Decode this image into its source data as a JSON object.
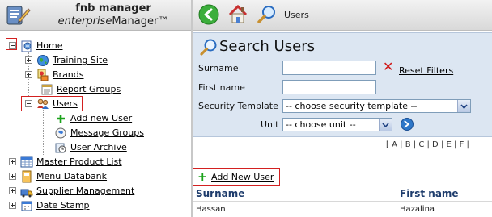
{
  "app": {
    "name": "fnb manager",
    "subtitle_prefix": "enterprise",
    "subtitle_rest": "Manager™"
  },
  "tree": {
    "home": "Home",
    "training_site": "Training Site",
    "brands": "Brands",
    "report_groups": "Report Groups",
    "users": "Users",
    "add_new_user": "Add new User",
    "message_groups": "Message Groups",
    "user_archive": "User Archive",
    "master_product_list": "Master Product List",
    "menu_databank": "Menu Databank",
    "supplier_management": "Supplier Management",
    "date_stamp": "Date Stamp"
  },
  "toolbar": {
    "title": "Users"
  },
  "search": {
    "title": "Search Users",
    "surname_label": "Surname",
    "surname_value": "",
    "first_name_label": "First name",
    "first_name_value": "",
    "security_template_label": "Security Template",
    "security_template_value": "-- choose security template --",
    "unit_label": "Unit",
    "unit_value": "-- choose unit --",
    "reset_filters": "Reset Filters"
  },
  "alpha_index": [
    "[",
    "A",
    "|",
    "B",
    "|",
    "C",
    "|",
    "D",
    "|",
    "E",
    "|",
    "F",
    "|"
  ],
  "add_new_user": "Add New User",
  "grid": {
    "columns": [
      "Surname",
      "First name"
    ],
    "rows": [
      [
        "Hassan",
        "Hazalina"
      ]
    ]
  },
  "colors": {
    "highlight_box": "#d32020",
    "search_panel_bg": "#dce6f2",
    "grid_header_text": "#1e3c6c",
    "add_plus": "#1aa21a"
  }
}
